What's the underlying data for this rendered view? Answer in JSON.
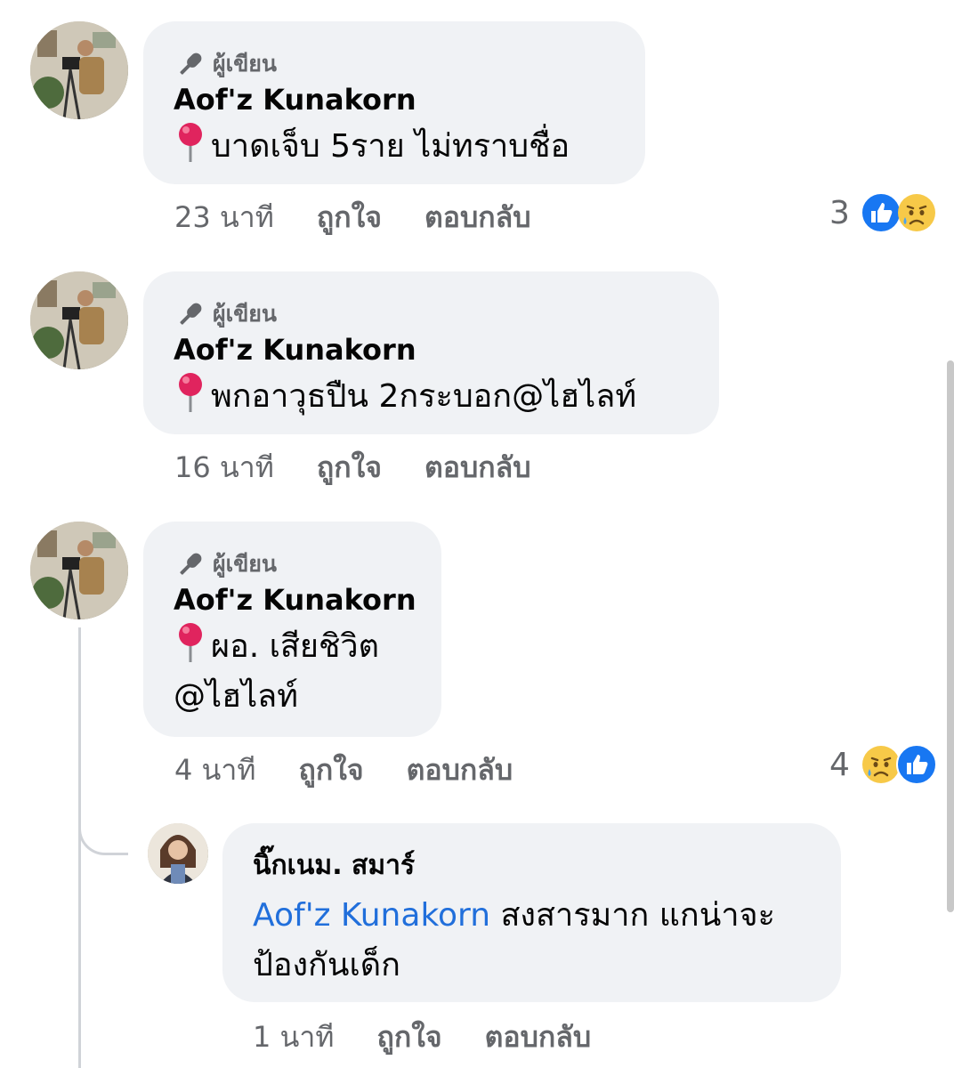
{
  "comments": [
    {
      "author_badge": "ผู้เขียน",
      "name": "Aof'z Kunakorn",
      "text": "บาดเจ็บ 5ราย ไม่ทราบชื่อ",
      "time": "23 นาที",
      "like_label": "ถูกใจ",
      "reply_label": "ตอบกลับ",
      "reaction_count": "3",
      "reactions": [
        "like-icon",
        "sad-icon"
      ]
    },
    {
      "author_badge": "ผู้เขียน",
      "name": "Aof'z Kunakorn",
      "text": "พกอาวุธปืน 2กระบอก@ไฮไลท์",
      "time": "16 นาที",
      "like_label": "ถูกใจ",
      "reply_label": "ตอบกลับ"
    },
    {
      "author_badge": "ผู้เขียน",
      "name": "Aof'z Kunakorn",
      "text_line1": "ผอ. เสียชิวิต",
      "text_line2": "@ไฮไลท์",
      "time": "4 นาที",
      "like_label": "ถูกใจ",
      "reply_label": "ตอบกลับ",
      "reaction_count": "4",
      "reactions": [
        "sad-icon",
        "like-icon"
      ]
    }
  ],
  "reply": {
    "name": "นิ๊กเนม. สมาร์",
    "mention": "Aof'z Kunakorn",
    "text_line1": " สงสารมาก แกน่าจะ",
    "text_line2": "ป้องกันเด็ก",
    "time": "1 นาที",
    "like_label": "ถูกใจ",
    "reply_label": "ตอบกลับ"
  },
  "colors": {
    "bubble": "#f0f2f5",
    "meta": "#65676b",
    "mention": "#216fdb",
    "like_blue": "#1877f2",
    "sad_yellow": "#f7c948"
  }
}
